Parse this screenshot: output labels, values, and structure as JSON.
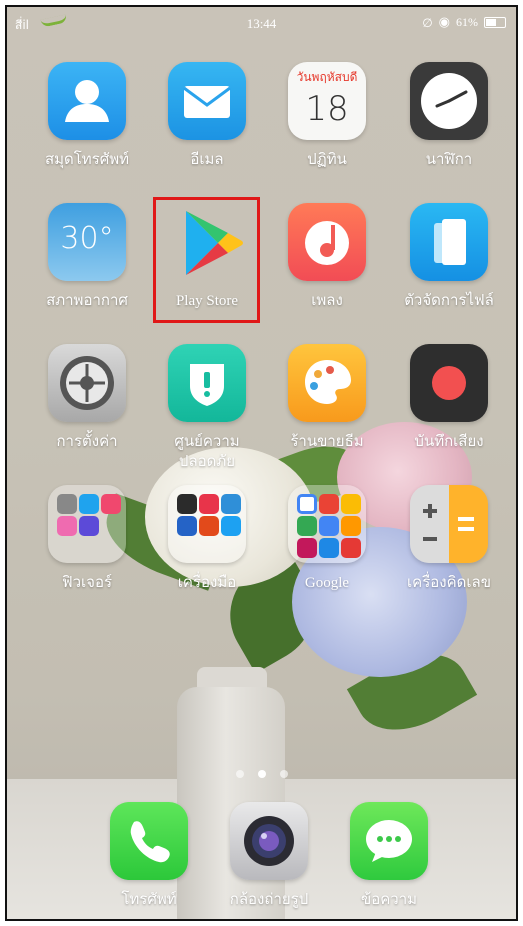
{
  "status_bar": {
    "signal": "สี่il",
    "time": "13:44",
    "battery": "61%",
    "battery_level": 0.61
  },
  "apps": [
    {
      "label": "สมุดโทรศัพท์"
    },
    {
      "label": "อีเมล"
    },
    {
      "label": "ปฏิทิน",
      "day_name": "วันพฤหัสบดี",
      "date": "18"
    },
    {
      "label": "นาฬิกา"
    },
    {
      "label": "สภาพอากาศ",
      "temp": "30°"
    },
    {
      "label": "Play Store"
    },
    {
      "label": "เพลง"
    },
    {
      "label": "ตัวจัดการไฟล์"
    },
    {
      "label": "การตั้งค่า"
    },
    {
      "label": "ศูนย์ความปลอดภัย"
    },
    {
      "label": "ร้านขายธีม"
    },
    {
      "label": "บันทึกเสียง"
    },
    {
      "label": "ฟิวเจอร์"
    },
    {
      "label": "เครื่องมือ"
    },
    {
      "label": "Google"
    },
    {
      "label": "เครื่องคิดเลข"
    }
  ],
  "dock": [
    {
      "label": "โทรศัพท์"
    },
    {
      "label": "กล้องถ่ายรูป"
    },
    {
      "label": "ข้อความ"
    }
  ],
  "page_indicator": {
    "count": 3,
    "active": 2
  },
  "colors": {
    "highlight": "#e01818",
    "accent_green": "#7db23a"
  }
}
